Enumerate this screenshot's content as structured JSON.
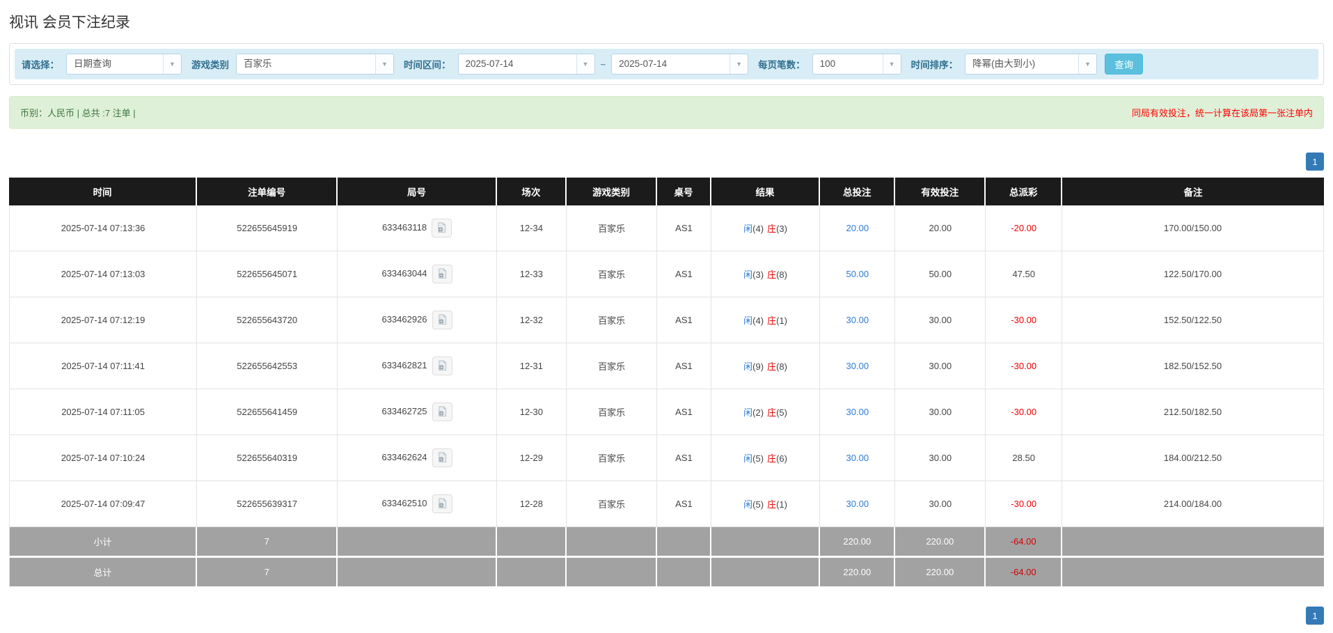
{
  "page": {
    "title": "视讯 会员下注纪录"
  },
  "icons": {
    "chevron_down": "▼"
  },
  "colors": {
    "filter_bar_bg": "#d9edf7",
    "filter_label": "#31708f",
    "search_button_bg": "#5bc0de",
    "alert_bg": "#dff0d8",
    "alert_text_green": "#3c763d",
    "notice_red": "#ff0000",
    "header_bg": "#1b1b1b",
    "bet_blue": "#2b7cd9",
    "loss_red": "#ee0000",
    "summary_row_bg": "#a2a2a2",
    "pagination_active_bg": "#337ab7"
  },
  "filters": {
    "select_label": "请选择：",
    "select_value": "日期查询",
    "game_label": "游戏类别",
    "game_value": "百家乐",
    "range_label": "时间区间：",
    "date_from": "2025-07-14",
    "tilde": "~",
    "date_to": "2025-07-14",
    "page_size_label": "每页笔数：",
    "page_size_value": "100",
    "sort_label": "时间排序：",
    "sort_value": "降幂(由大到小)",
    "search_button": "查询"
  },
  "summary_bar": {
    "left": "币别：人民币 | 总共 :7 注单 |",
    "right": "同局有效投注，统一计算在该局第一张注单内"
  },
  "pagination": {
    "page": "1"
  },
  "table": {
    "headers": [
      "时间",
      "注单编号",
      "局号",
      "场次",
      "游戏类别",
      "桌号",
      "结果",
      "总投注",
      "有效投注",
      "总派彩",
      "备注"
    ],
    "rows": [
      {
        "time": "2025-07-14 07:13:36",
        "bet_id": "522655645919",
        "round_id": "633463118",
        "session": "12-34",
        "game": "百家乐",
        "table_no": "AS1",
        "result_player_label": "闲",
        "result_player_value": "(4)",
        "result_banker_label": "庄",
        "result_banker_value": "(3)",
        "total_bet": "20.00",
        "valid_bet": "20.00",
        "payout": "-20.00",
        "remark": "170.00/150.00"
      },
      {
        "time": "2025-07-14 07:13:03",
        "bet_id": "522655645071",
        "round_id": "633463044",
        "session": "12-33",
        "game": "百家乐",
        "table_no": "AS1",
        "result_player_label": "闲",
        "result_player_value": "(3)",
        "result_banker_label": "庄",
        "result_banker_value": "(8)",
        "total_bet": "50.00",
        "valid_bet": "50.00",
        "payout": "47.50",
        "remark": "122.50/170.00"
      },
      {
        "time": "2025-07-14 07:12:19",
        "bet_id": "522655643720",
        "round_id": "633462926",
        "session": "12-32",
        "game": "百家乐",
        "table_no": "AS1",
        "result_player_label": "闲",
        "result_player_value": "(4)",
        "result_banker_label": "庄",
        "result_banker_value": "(1)",
        "total_bet": "30.00",
        "valid_bet": "30.00",
        "payout": "-30.00",
        "remark": "152.50/122.50"
      },
      {
        "time": "2025-07-14 07:11:41",
        "bet_id": "522655642553",
        "round_id": "633462821",
        "session": "12-31",
        "game": "百家乐",
        "table_no": "AS1",
        "result_player_label": "闲",
        "result_player_value": "(9)",
        "result_banker_label": "庄",
        "result_banker_value": "(8)",
        "total_bet": "30.00",
        "valid_bet": "30.00",
        "payout": "-30.00",
        "remark": "182.50/152.50"
      },
      {
        "time": "2025-07-14 07:11:05",
        "bet_id": "522655641459",
        "round_id": "633462725",
        "session": "12-30",
        "game": "百家乐",
        "table_no": "AS1",
        "result_player_label": "闲",
        "result_player_value": "(2)",
        "result_banker_label": "庄",
        "result_banker_value": "(5)",
        "total_bet": "30.00",
        "valid_bet": "30.00",
        "payout": "-30.00",
        "remark": "212.50/182.50"
      },
      {
        "time": "2025-07-14 07:10:24",
        "bet_id": "522655640319",
        "round_id": "633462624",
        "session": "12-29",
        "game": "百家乐",
        "table_no": "AS1",
        "result_player_label": "闲",
        "result_player_value": "(5)",
        "result_banker_label": "庄",
        "result_banker_value": "(6)",
        "total_bet": "30.00",
        "valid_bet": "30.00",
        "payout": "28.50",
        "remark": "184.00/212.50"
      },
      {
        "time": "2025-07-14 07:09:47",
        "bet_id": "522655639317",
        "round_id": "633462510",
        "session": "12-28",
        "game": "百家乐",
        "table_no": "AS1",
        "result_player_label": "闲",
        "result_player_value": "(5)",
        "result_banker_label": "庄",
        "result_banker_value": "(1)",
        "total_bet": "30.00",
        "valid_bet": "30.00",
        "payout": "-30.00",
        "remark": "214.00/184.00"
      }
    ],
    "subtotal": {
      "label": "小计",
      "count": "7",
      "total_bet": "220.00",
      "valid_bet": "220.00",
      "payout": "-64.00"
    },
    "grand_total": {
      "label": "总计",
      "count": "7",
      "total_bet": "220.00",
      "valid_bet": "220.00",
      "payout": "-64.00"
    }
  }
}
